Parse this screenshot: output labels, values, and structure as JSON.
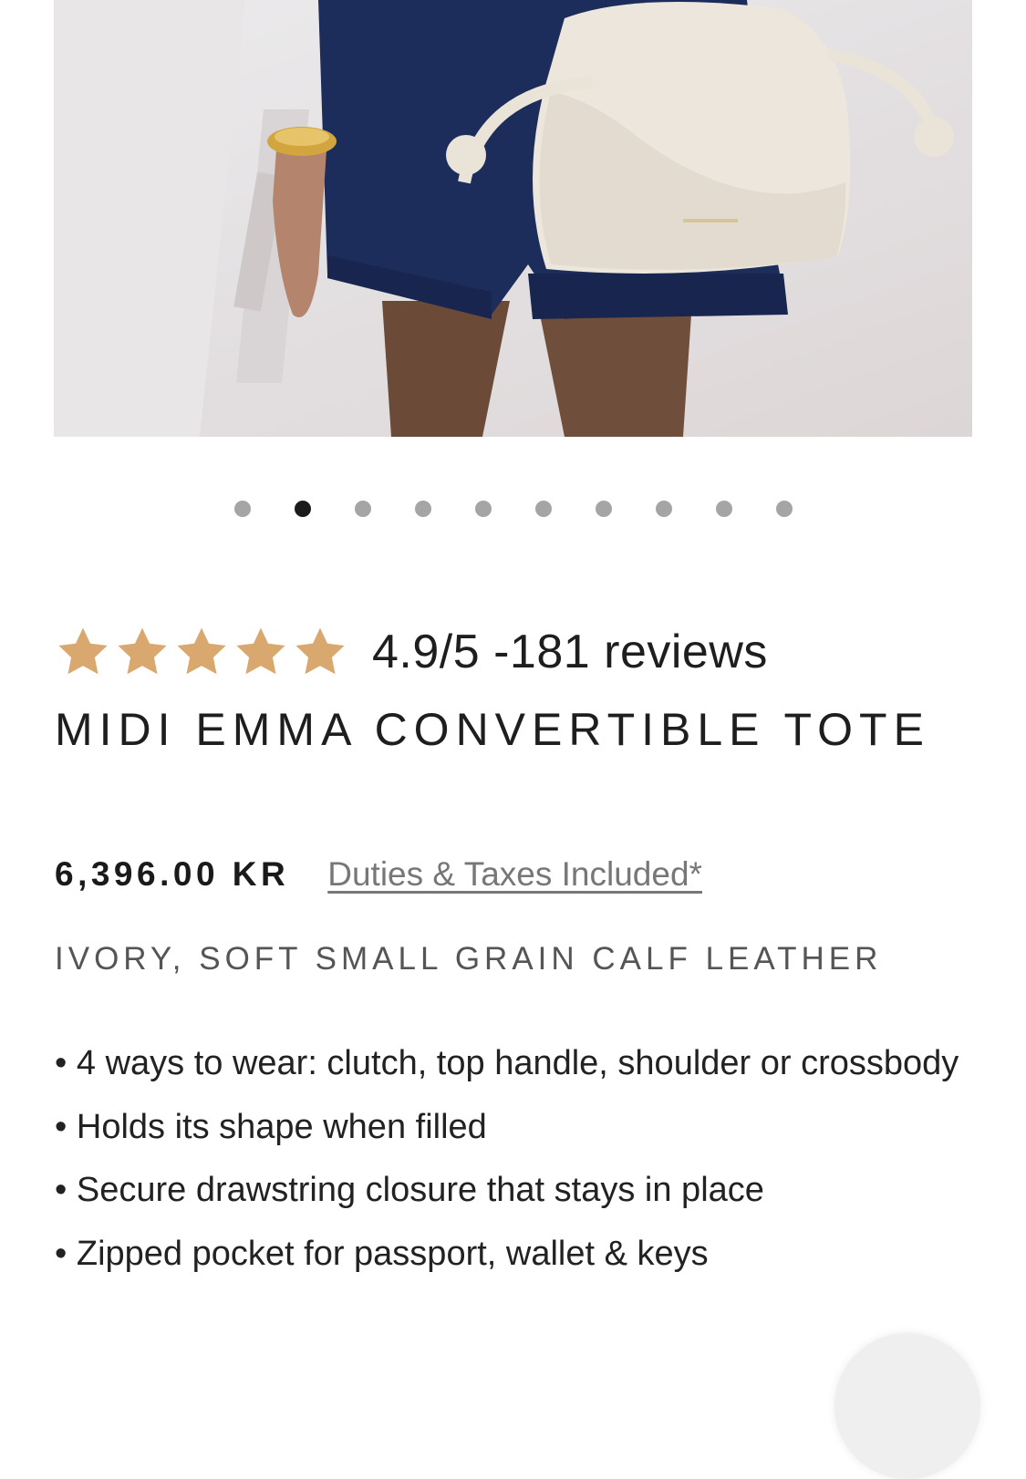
{
  "gallery": {
    "slide_count": 10,
    "active_index": 1
  },
  "rating": {
    "stars": 5,
    "text": "4.9/5 -181 reviews",
    "star_color": "#d8a86f"
  },
  "product": {
    "title": "MIDI EMMA CONVERTIBLE TOTE",
    "price": "6,396.00 KR",
    "duties_link": "Duties & Taxes Included*",
    "material": "IVORY, SOFT SMALL GRAIN CALF LEATHER",
    "features": [
      "4 ways to wear: clutch, top handle, shoulder or crossbody",
      "Holds its shape when filled",
      "Secure drawstring closure that stays in place",
      "Zipped pocket for passport, wallet & keys"
    ]
  },
  "colors": {
    "bag": "#ece6dc",
    "shorts": "#1c2d5c",
    "dot_active": "#1b1b1b",
    "dot_inactive": "#a5a5a5"
  }
}
